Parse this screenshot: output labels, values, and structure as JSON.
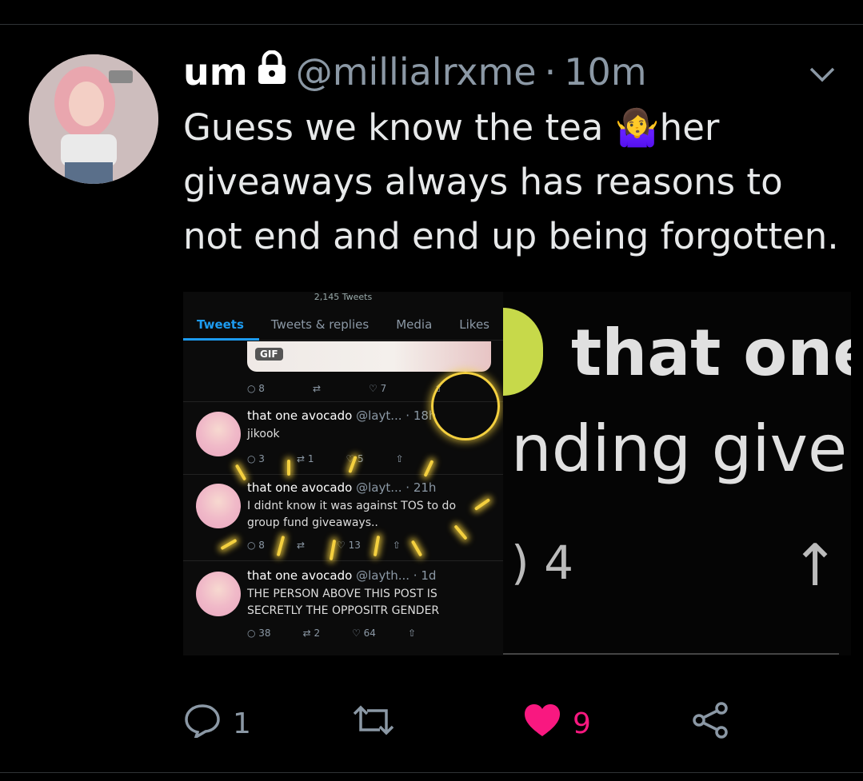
{
  "tweet": {
    "display_name": "um",
    "handle": "@millialrxme",
    "separator": "·",
    "time": "10m",
    "text": "Guess we know the tea 🤷‍♀️her giveaways always has reasons to not end and end up being forgotten."
  },
  "media": {
    "screenshot": {
      "tweet_count": "2,145 Tweets",
      "tabs": [
        "Tweets",
        "Tweets & replies",
        "Media",
        "Likes"
      ],
      "gif_label": "GIF",
      "top_actions": {
        "replies": "8",
        "likes": "7"
      },
      "posts": [
        {
          "name": "that one avocado",
          "handle": "@layt...",
          "time": "· 18h",
          "text": "jikook",
          "replies": "3",
          "retweets": "1",
          "likes": "5"
        },
        {
          "name": "that one avocado",
          "handle": "@layt...",
          "time": "· 21h",
          "text": "I didnt know it was against TOS to do group fund giveaways..",
          "replies": "8",
          "retweets": "",
          "likes": "13"
        },
        {
          "name": "that one avocado",
          "handle": "@layth...",
          "time": "· 1d",
          "text": "THE PERSON ABOVE THIS POST IS SECRETLY THE OPPOSITR GENDER",
          "replies": "38",
          "retweets": "2",
          "likes": "64"
        }
      ]
    },
    "zoom": {
      "line1": "that one",
      "line2": "nding give",
      "count": "4"
    }
  },
  "actions": {
    "replies": "1",
    "likes": "9"
  },
  "colors": {
    "like": "#f91880",
    "accent": "#1d9bf0",
    "highlight": "#f4d03f"
  },
  "icons": [
    "lock-icon",
    "chevron-down-icon",
    "reply-icon",
    "retweet-icon",
    "heart-icon",
    "share-icon"
  ]
}
